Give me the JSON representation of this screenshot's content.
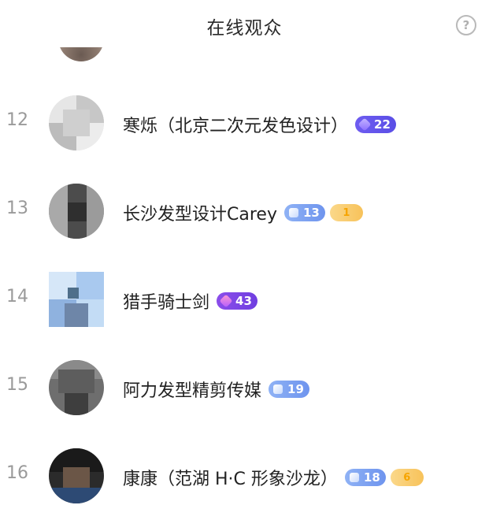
{
  "header": {
    "title": "在线观众",
    "help_icon": "question-circle-icon",
    "help_glyph": "?"
  },
  "viewers": [
    {
      "rank": "12",
      "name": "寒烁（北京二次元发色设计）",
      "badge_level": "22",
      "badge_style": "purple",
      "fan_level": null
    },
    {
      "rank": "13",
      "name": "长沙发型设计Carey",
      "badge_level": "13",
      "badge_style": "blue",
      "fan_level": "1"
    },
    {
      "rank": "14",
      "name": "猎手骑士剑",
      "badge_level": "43",
      "badge_style": "violet",
      "fan_level": null
    },
    {
      "rank": "15",
      "name": "阿力发型精剪传媒",
      "badge_level": "19",
      "badge_style": "blue",
      "fan_level": null
    },
    {
      "rank": "16",
      "name": "康康（范湖 H·C 形象沙龙）",
      "badge_level": "18",
      "badge_style": "blue",
      "fan_level": "6"
    }
  ],
  "colors": {
    "badge_purple": "#5a4ee6",
    "badge_violet": "#6f3ee0",
    "badge_blue": "#6e94ee",
    "fan_gold": "#f7c25a",
    "rank_gray": "#9a9a9a"
  }
}
